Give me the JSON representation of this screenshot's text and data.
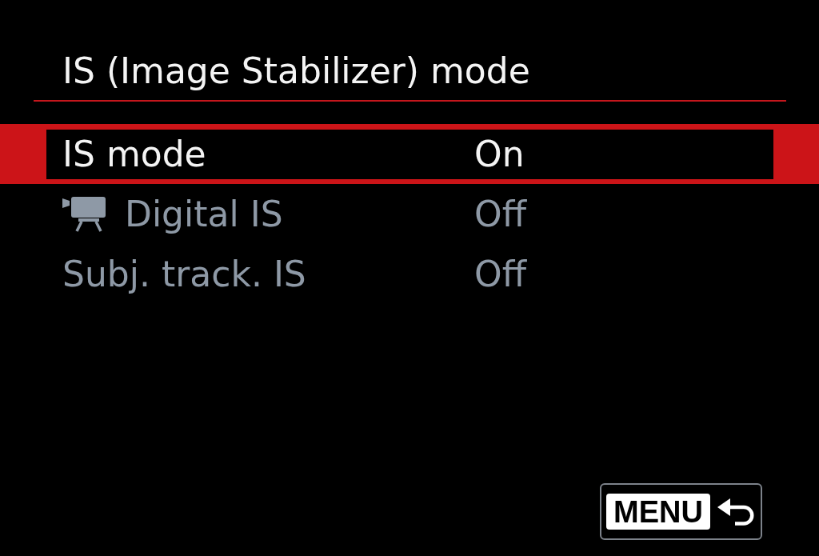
{
  "screen": {
    "title": "IS (Image Stabilizer) mode"
  },
  "items": [
    {
      "kind": "plain",
      "label": "IS mode",
      "value": "On",
      "selected": true,
      "disabled": false
    },
    {
      "kind": "movie",
      "label": "Digital IS",
      "value": "Off",
      "selected": false,
      "disabled": true
    },
    {
      "kind": "plain",
      "label": "Subj. track. IS",
      "value": "Off",
      "selected": false,
      "disabled": true
    }
  ],
  "footer": {
    "button": {
      "label": "MENU"
    }
  }
}
